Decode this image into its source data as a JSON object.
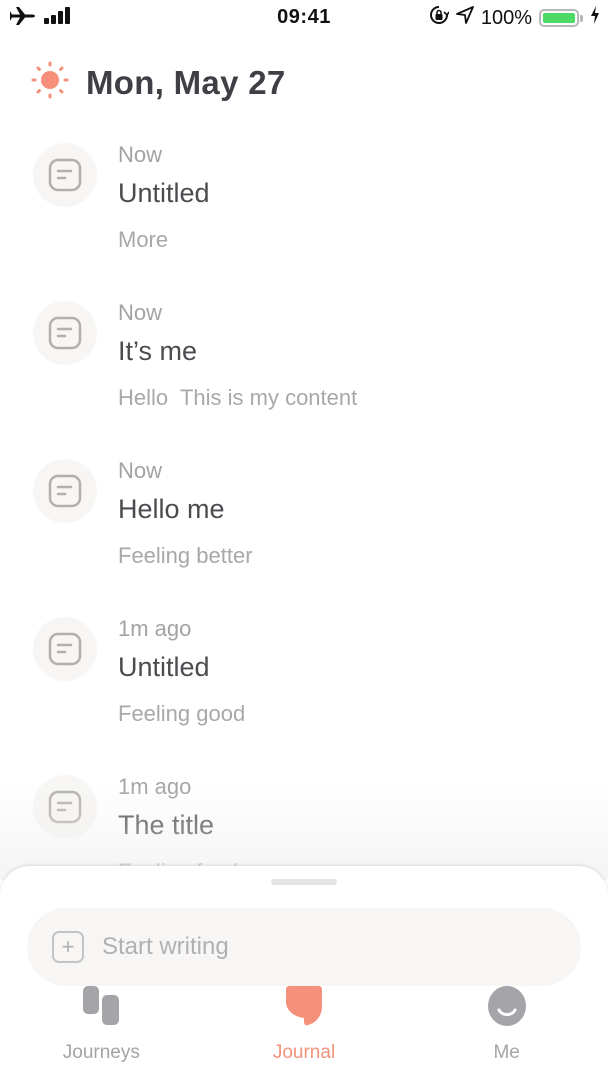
{
  "status_bar": {
    "time": "09:41",
    "battery_percent_text": "100%",
    "battery_level": 1.0,
    "icons": [
      "airplane-icon",
      "signal-icon",
      "orientation-lock-icon",
      "location-icon",
      "battery-icon",
      "charging-icon"
    ]
  },
  "header": {
    "weather_icon": "sun-icon",
    "date": "Mon, May 27"
  },
  "entries": [
    {
      "icon": "note-icon",
      "time": "Now",
      "title": "Untitled",
      "body": "More"
    },
    {
      "icon": "note-icon",
      "time": "Now",
      "title": "It’s me",
      "body": "Hello  This is my content"
    },
    {
      "icon": "note-icon",
      "time": "Now",
      "title": "Hello me",
      "body": "Feeling better"
    },
    {
      "icon": "note-icon",
      "time": "1m ago",
      "title": "Untitled",
      "body": "Feeling good"
    },
    {
      "icon": "note-icon",
      "time": "1m ago",
      "title": "The title",
      "body": "Feeling fresh"
    }
  ],
  "composer": {
    "icon": "plus-square-icon",
    "placeholder": "Start writing",
    "value": ""
  },
  "tab_bar": {
    "active": "Journal",
    "tabs": [
      {
        "label": "Journeys",
        "icon": "journeys-icon"
      },
      {
        "label": "Journal",
        "icon": "journal-icon"
      },
      {
        "label": "Me",
        "icon": "smiley-icon"
      }
    ]
  },
  "colors": {
    "accent": "#f3937c",
    "inactive": "#a4a4a8",
    "battery": "#4cd964",
    "title_text": "#3f3f45"
  }
}
